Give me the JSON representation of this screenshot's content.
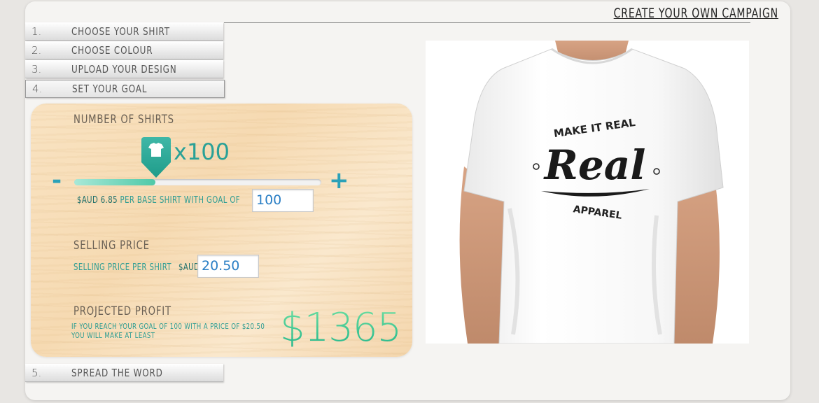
{
  "header": {
    "title": "CREATE YOUR OWN CAMPAIGN"
  },
  "steps": [
    {
      "num": "1.",
      "label": "CHOOSE YOUR SHIRT"
    },
    {
      "num": "2.",
      "label": "CHOOSE  COLOUR"
    },
    {
      "num": "3.",
      "label": "UPLOAD YOUR DESIGN"
    },
    {
      "num": "4.",
      "label": "SET YOUR GOAL"
    },
    {
      "num": "5.",
      "label": "SPREAD THE WORD"
    }
  ],
  "goal": {
    "shirts_title": "NUMBER OF SHIRTS",
    "shirt_count_label": "x100",
    "slider_value": 0.33,
    "minus": "-",
    "plus": "+",
    "base_price_prefix": "$AUD 6.85",
    "base_price_text": "PER BASE SHIRT WITH GOAL OF",
    "goal_value": "100",
    "selling_title": "SELLING PRICE",
    "selling_label": "SELLING PRICE PER SHIRT",
    "currency": "$AUD",
    "selling_value": "20.50",
    "profit_title": "PROJECTED PROFIT",
    "profit_line1": "IF YOU REACH YOUR GOAL OF 100 WITH A PRICE OF $20.50",
    "profit_line2": "YOU WILL MAKE AT LEAST",
    "profit_value": "$1365"
  },
  "shirt_graphic": {
    "top_text": "MAKE IT REAL",
    "main_text": "Real",
    "bottom_text": "APPAREL"
  },
  "colors": {
    "teal": "#2aa197",
    "profit_green": "#3dca8f",
    "plus_blue": "#2aa1b8"
  }
}
